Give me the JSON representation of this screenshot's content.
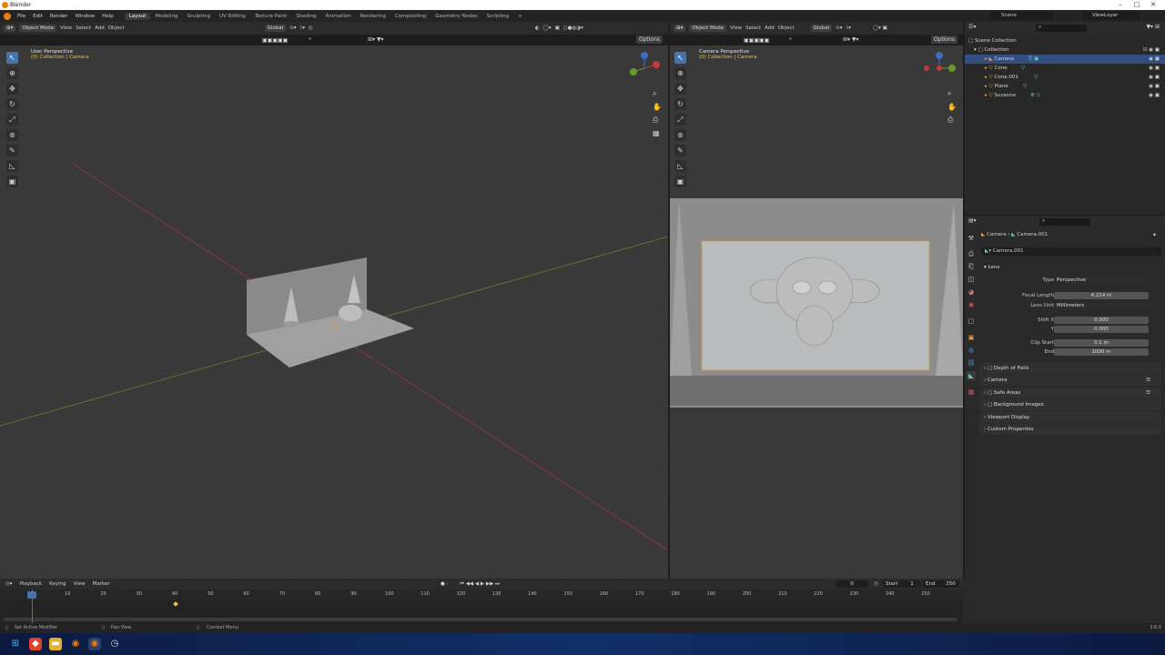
{
  "window": {
    "title": "Blender"
  },
  "menubar": {
    "menus": [
      "File",
      "Edit",
      "Render",
      "Window",
      "Help"
    ],
    "workspaces": [
      "Layout",
      "Modeling",
      "Sculpting",
      "UV Editing",
      "Texture Paint",
      "Shading",
      "Animation",
      "Rendering",
      "Compositing",
      "Geometry Nodes",
      "Scripting"
    ],
    "active_workspace": "Layout",
    "add_tab": "+",
    "scene_label": "Scene",
    "viewlayer_label": "ViewLayer"
  },
  "left_viewport": {
    "mode": "Object Mode",
    "menus": [
      "View",
      "Select",
      "Add",
      "Object"
    ],
    "orientation": "Global",
    "options": "Options",
    "title": "User Perspective",
    "subtitle": "(0) Collection | Camera"
  },
  "right_viewport": {
    "mode": "Object Mode",
    "menus": [
      "View",
      "Select",
      "Add",
      "Object"
    ],
    "orientation": "Global",
    "options": "Options",
    "title": "Camera Perspective",
    "subtitle": "(0) Collection | Camera"
  },
  "outliner": {
    "root": "Scene Collection",
    "collection": "Collection",
    "items": [
      {
        "name": "Camera",
        "selected": true
      },
      {
        "name": "Cone",
        "selected": false
      },
      {
        "name": "Cone.001",
        "selected": false
      },
      {
        "name": "Plane",
        "selected": false
      },
      {
        "name": "Suzanne",
        "selected": false
      }
    ]
  },
  "properties": {
    "breadcrumb": [
      "Camera",
      "Camera.001"
    ],
    "datablock": "Camera.001",
    "lens_panel": "Lens",
    "type_label": "Type",
    "type_value": "Perspective",
    "focal_label": "Focal Length",
    "focal_value": "4.214 m",
    "lens_unit_label": "Lens Unit",
    "lens_unit_value": "Millimeters",
    "shift_x_label": "Shift X",
    "shift_x_value": "0.000",
    "shift_y_label": "Y",
    "shift_y_value": "0.000",
    "clip_start_label": "Clip Start",
    "clip_start_value": "0.1 m",
    "clip_end_label": "End",
    "clip_end_value": "1000 m",
    "collapsed_panels": [
      "Depth of Field",
      "Camera",
      "Safe Areas",
      "Background Images",
      "Viewport Display",
      "Custom Properties"
    ]
  },
  "timeline": {
    "menus": [
      "Playback",
      "Keying",
      "View",
      "Marker"
    ],
    "current_frame": "0",
    "start_label": "Start",
    "start_value": "1",
    "end_label": "End",
    "end_value": "250",
    "ruler": [
      "0",
      "10",
      "20",
      "30",
      "40",
      "50",
      "60",
      "70",
      "80",
      "90",
      "100",
      "110",
      "120",
      "130",
      "140",
      "150",
      "160",
      "170",
      "180",
      "190",
      "200",
      "210",
      "220",
      "230",
      "240",
      "250"
    ]
  },
  "statusbar": {
    "left": "Set Active Modifier",
    "middle": "Pan View",
    "right": "Context Menu",
    "version": "3.6.0"
  },
  "colors": {
    "accent": "#4772b3",
    "selection": "#334d80",
    "subtitle": "#e0c64a",
    "x_axis": "#c23a3a",
    "y_axis": "#6a9a2a"
  }
}
